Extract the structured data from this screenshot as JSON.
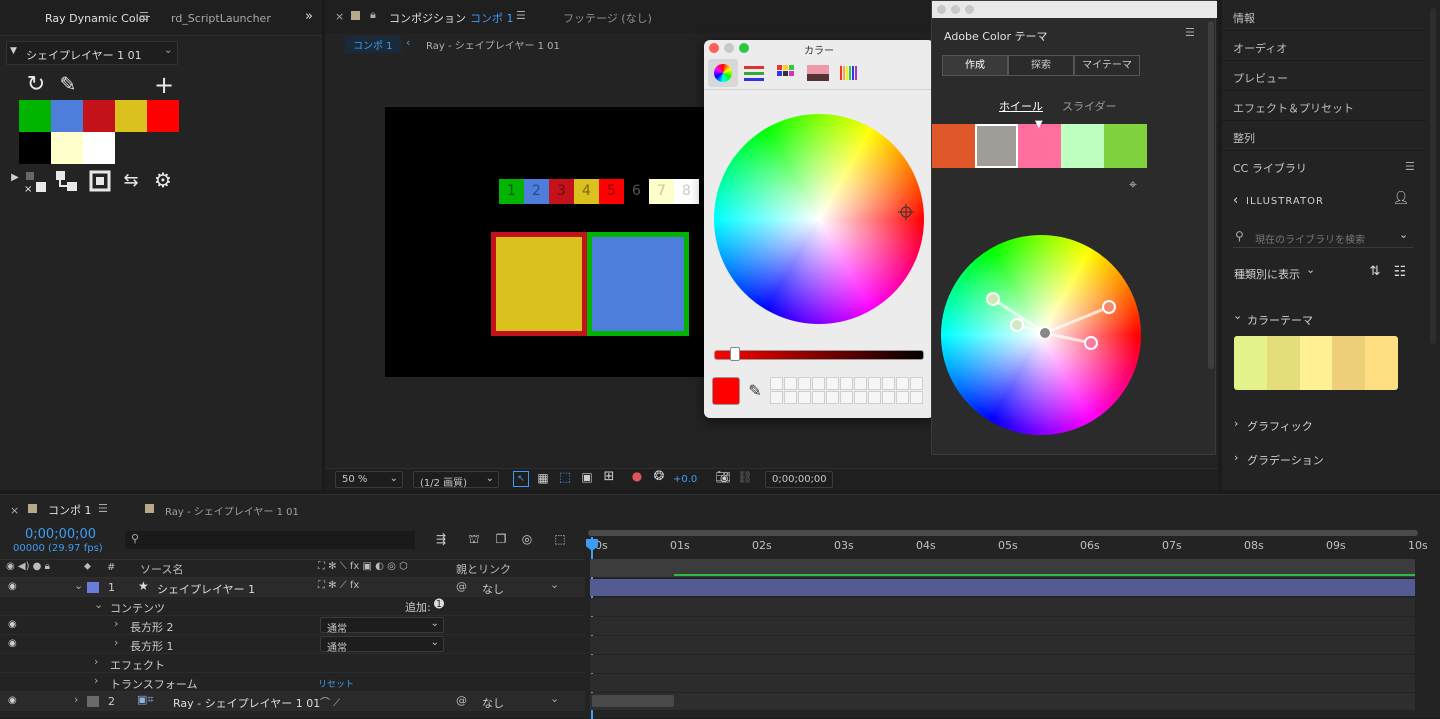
{
  "left_panel": {
    "tab1": "Ray Dynamic Color",
    "tab2": "rd_ScriptLauncher",
    "layer_select": "シェイプレイヤー 1 01",
    "palette": [
      "#00b400",
      "#4f7ddb",
      "#c4121b",
      "#dbc11e",
      "#ff0000",
      "#000000",
      "#ffffcc",
      "#ffffff"
    ]
  },
  "comp_panel": {
    "tab_label": "コンポジション",
    "tab_comp": "コンポ 1",
    "footage_tab": "フッテージ (なし)",
    "breadcrumb_comp": "コンポ 1",
    "breadcrumb_layer": "Ray - シェイプレイヤー 1 01",
    "zoom": "50 %",
    "resolution": "(1/2 画質)",
    "exposure": "+0.0",
    "timecode": "0;00;00;00",
    "chips": [
      {
        "label": "1",
        "bg": "#00b400",
        "fg": "#0f5a0f"
      },
      {
        "label": "2",
        "bg": "#4f7ddb",
        "fg": "#2b4a8a"
      },
      {
        "label": "3",
        "bg": "#c4121b",
        "fg": "#6a0b0f"
      },
      {
        "label": "4",
        "bg": "#dbc11e",
        "fg": "#7a6a10"
      },
      {
        "label": "5",
        "bg": "#ff0000",
        "fg": "#8a0000"
      },
      {
        "label": "6",
        "bg": "#000000",
        "fg": "#555555"
      },
      {
        "label": "7",
        "bg": "#ffffcc",
        "fg": "#c8c8a0"
      },
      {
        "label": "8",
        "bg": "#ffffff",
        "fg": "#cccccc"
      }
    ]
  },
  "color_picker": {
    "title": "カラー",
    "selected_color": "#ff0000"
  },
  "adobe_color": {
    "title": "Adobe Color テーマ",
    "tabs": [
      "作成",
      "探索",
      "マイテーマ"
    ],
    "modes": [
      "ホイール",
      "スライダー"
    ],
    "swatches": [
      "#e0582a",
      "#a09c98",
      "#ff6e9c",
      "#bfffbf",
      "#7fd13d"
    ]
  },
  "right_panel": {
    "sections": [
      "情報",
      "オーディオ",
      "プレビュー",
      "エフェクト＆プリセット",
      "整列"
    ],
    "cc_libraries": "CC ライブラリ",
    "library_name": "ILLUSTRATOR",
    "search_placeholder": "現在のライブラリを検索",
    "view_by": "種類別に表示",
    "color_theme": "カラーテーマ",
    "theme_colors": [
      "#e5f28c",
      "#e3de7a",
      "#fff094",
      "#eed07a",
      "#ffdf82"
    ],
    "graphics": "グラフィック",
    "gradients": "グラデーション"
  },
  "timeline": {
    "tab_comp": "コンポ 1",
    "tab_layer": "Ray - シェイプレイヤー 1 01",
    "timecode": "0;00;00;00",
    "frames": "00000 (29.97 fps)",
    "col_num": "#",
    "col_source": "ソース名",
    "col_parent": "親とリンク",
    "ruler": [
      "00s",
      "01s",
      "02s",
      "03s",
      "04s",
      "05s",
      "06s",
      "07s",
      "08s",
      "09s",
      "10s"
    ],
    "layer1_num": "1",
    "layer1_name": "シェイプレイヤー 1",
    "layer1_parent": "なし",
    "contents": "コンテンツ",
    "add": "追加:",
    "rect2": "長方形 2",
    "rect1": "長方形 1",
    "mode": "通常",
    "effects": "エフェクト",
    "transform": "トランスフォーム",
    "reset": "リセット",
    "layer2_num": "2",
    "layer2_name": "Ray - シェイプレイヤー 1 01",
    "layer2_parent": "なし"
  }
}
